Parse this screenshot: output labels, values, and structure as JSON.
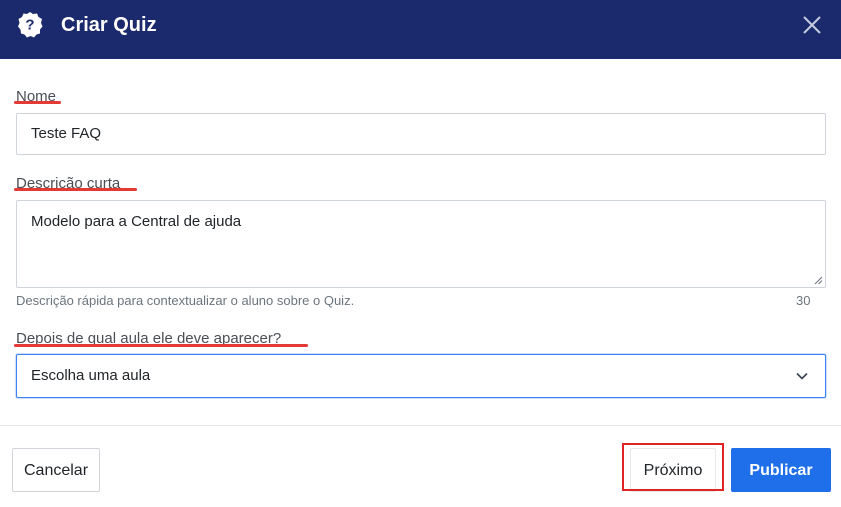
{
  "modal": {
    "title": "Criar Quiz",
    "header_color": "#1a2a6c",
    "help_icon": "question-circle-icon",
    "close_icon": "close-icon"
  },
  "form": {
    "name": {
      "label": "Nome",
      "value": "Teste FAQ"
    },
    "description": {
      "label": "Descrição curta",
      "value": "Modelo para a Central de ajuda",
      "helper": "Descrição rápida para contextualizar o aluno sobre o Quiz.",
      "counter": "30"
    },
    "lesson": {
      "label": "Depois de qual aula ele deve aparecer?",
      "selected": "Escolha uma aula"
    }
  },
  "footer": {
    "cancel_label": "Cancelar",
    "next_label": "Próximo",
    "publish_label": "Publicar",
    "publish_color": "#1f6feb"
  },
  "annotations": {
    "underline_color": "#e53935",
    "highlight_color": "#e02424"
  }
}
